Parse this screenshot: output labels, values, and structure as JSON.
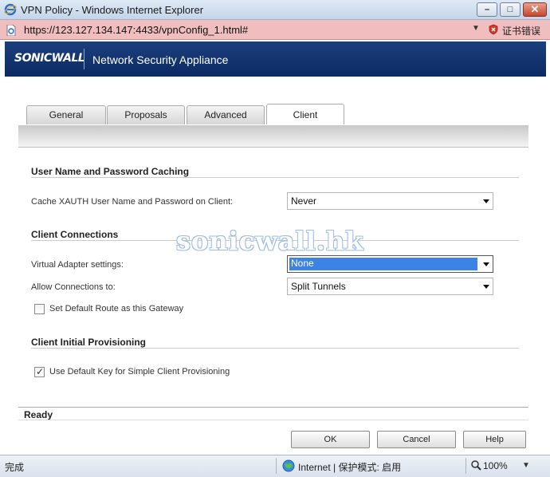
{
  "window": {
    "title": "VPN Policy - Windows Internet Explorer"
  },
  "address": {
    "url": "https://123.127.134.147:4433/vpnConfig_1.html#",
    "cert_error": "证书错误"
  },
  "header": {
    "logo": "SONICWALL",
    "product": "Network Security Appliance"
  },
  "tabs": [
    {
      "label": "General"
    },
    {
      "label": "Proposals"
    },
    {
      "label": "Advanced"
    },
    {
      "label": "Client"
    }
  ],
  "active_tab": "Client",
  "sections": {
    "caching": {
      "title": "User Name and Password Caching",
      "cache_label": "Cache XAUTH User Name and Password on Client:",
      "cache_value": "Never"
    },
    "connections": {
      "title": "Client Connections",
      "adapter_label": "Virtual Adapter settings:",
      "adapter_value": "None",
      "allow_label": "Allow Connections to:",
      "allow_value": "Split Tunnels",
      "default_route_label": "Set Default Route as this Gateway",
      "default_route_checked": false
    },
    "provisioning": {
      "title": "Client Initial Provisioning",
      "default_key_label": "Use Default Key for Simple Client Provisioning",
      "default_key_checked": true
    }
  },
  "watermark": "sonicwall.hk",
  "status": {
    "ready": "Ready"
  },
  "buttons": {
    "ok": "OK",
    "cancel": "Cancel",
    "help": "Help"
  },
  "statusbar": {
    "done": "完成",
    "zone": "Internet | 保护模式: 启用",
    "zoom": "100%"
  },
  "colors": {
    "header_bg": "#0b2a63",
    "address_bg": "#f0bebe",
    "selection": "#3d82e5"
  }
}
